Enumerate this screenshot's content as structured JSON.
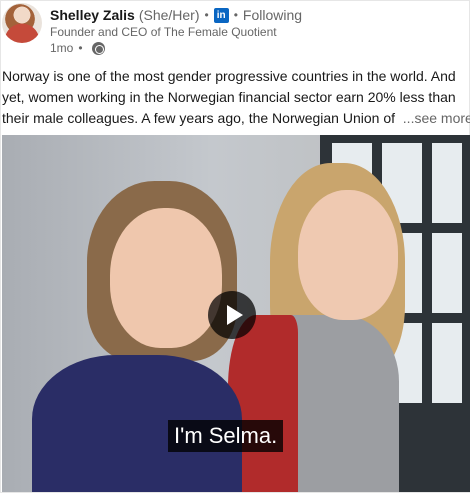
{
  "author": {
    "name": "Shelley Zalis",
    "pronouns": "(She/Her)",
    "network_icon": "linkedin-icon",
    "network_label": "in",
    "follow_status": "Following",
    "headline": "Founder and CEO of The Female Quotient",
    "time_ago": "1mo",
    "visibility_icon": "globe-icon"
  },
  "post": {
    "lines": [
      "Norway is one of the most gender progressive countries in the world. And",
      "yet, women working in the Norwegian financial sector earn 20% less than",
      "their male colleagues. A few years ago, the Norwegian Union of"
    ],
    "see_more": "...see more"
  },
  "video": {
    "caption": "I'm Selma.",
    "play_icon": "play-icon"
  },
  "separators": {
    "dot": "•"
  },
  "colors": {
    "brand_blue": "#0a66c2",
    "muted_text": "#666666"
  }
}
